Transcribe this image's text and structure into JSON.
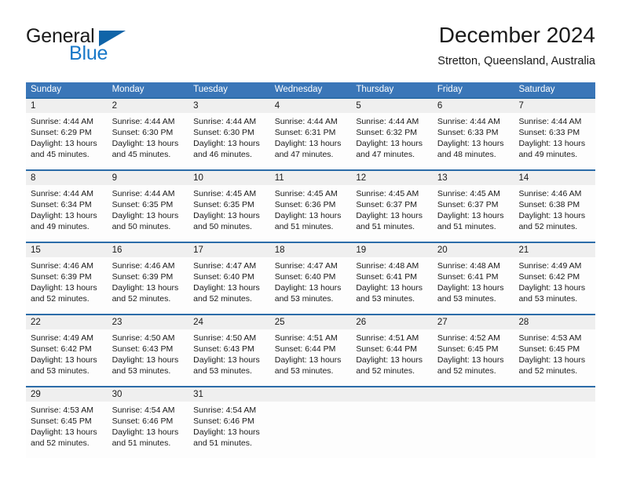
{
  "logo": {
    "text_top": "General",
    "text_bottom": "Blue",
    "icon": "triangle-logo-mark",
    "color_dark": "#1a1a1a",
    "color_blue": "#1878c8"
  },
  "header": {
    "title": "December 2024",
    "subtitle": "Stretton, Queensland, Australia"
  },
  "theme": {
    "header_blue": "#3a76b8",
    "row_divider_blue": "#2b6ca8",
    "daynum_band": "#efefef",
    "cell_background": "#fdfdfd",
    "text": "#1a1a1a"
  },
  "calendar": {
    "weekday_headers": [
      "Sunday",
      "Monday",
      "Tuesday",
      "Wednesday",
      "Thursday",
      "Friday",
      "Saturday"
    ],
    "weeks": [
      [
        {
          "day": "1",
          "sunrise": "Sunrise: 4:44 AM",
          "sunset": "Sunset: 6:29 PM",
          "daylight_1": "Daylight: 13 hours",
          "daylight_2": "and 45 minutes."
        },
        {
          "day": "2",
          "sunrise": "Sunrise: 4:44 AM",
          "sunset": "Sunset: 6:30 PM",
          "daylight_1": "Daylight: 13 hours",
          "daylight_2": "and 45 minutes."
        },
        {
          "day": "3",
          "sunrise": "Sunrise: 4:44 AM",
          "sunset": "Sunset: 6:30 PM",
          "daylight_1": "Daylight: 13 hours",
          "daylight_2": "and 46 minutes."
        },
        {
          "day": "4",
          "sunrise": "Sunrise: 4:44 AM",
          "sunset": "Sunset: 6:31 PM",
          "daylight_1": "Daylight: 13 hours",
          "daylight_2": "and 47 minutes."
        },
        {
          "day": "5",
          "sunrise": "Sunrise: 4:44 AM",
          "sunset": "Sunset: 6:32 PM",
          "daylight_1": "Daylight: 13 hours",
          "daylight_2": "and 47 minutes."
        },
        {
          "day": "6",
          "sunrise": "Sunrise: 4:44 AM",
          "sunset": "Sunset: 6:33 PM",
          "daylight_1": "Daylight: 13 hours",
          "daylight_2": "and 48 minutes."
        },
        {
          "day": "7",
          "sunrise": "Sunrise: 4:44 AM",
          "sunset": "Sunset: 6:33 PM",
          "daylight_1": "Daylight: 13 hours",
          "daylight_2": "and 49 minutes."
        }
      ],
      [
        {
          "day": "8",
          "sunrise": "Sunrise: 4:44 AM",
          "sunset": "Sunset: 6:34 PM",
          "daylight_1": "Daylight: 13 hours",
          "daylight_2": "and 49 minutes."
        },
        {
          "day": "9",
          "sunrise": "Sunrise: 4:44 AM",
          "sunset": "Sunset: 6:35 PM",
          "daylight_1": "Daylight: 13 hours",
          "daylight_2": "and 50 minutes."
        },
        {
          "day": "10",
          "sunrise": "Sunrise: 4:45 AM",
          "sunset": "Sunset: 6:35 PM",
          "daylight_1": "Daylight: 13 hours",
          "daylight_2": "and 50 minutes."
        },
        {
          "day": "11",
          "sunrise": "Sunrise: 4:45 AM",
          "sunset": "Sunset: 6:36 PM",
          "daylight_1": "Daylight: 13 hours",
          "daylight_2": "and 51 minutes."
        },
        {
          "day": "12",
          "sunrise": "Sunrise: 4:45 AM",
          "sunset": "Sunset: 6:37 PM",
          "daylight_1": "Daylight: 13 hours",
          "daylight_2": "and 51 minutes."
        },
        {
          "day": "13",
          "sunrise": "Sunrise: 4:45 AM",
          "sunset": "Sunset: 6:37 PM",
          "daylight_1": "Daylight: 13 hours",
          "daylight_2": "and 51 minutes."
        },
        {
          "day": "14",
          "sunrise": "Sunrise: 4:46 AM",
          "sunset": "Sunset: 6:38 PM",
          "daylight_1": "Daylight: 13 hours",
          "daylight_2": "and 52 minutes."
        }
      ],
      [
        {
          "day": "15",
          "sunrise": "Sunrise: 4:46 AM",
          "sunset": "Sunset: 6:39 PM",
          "daylight_1": "Daylight: 13 hours",
          "daylight_2": "and 52 minutes."
        },
        {
          "day": "16",
          "sunrise": "Sunrise: 4:46 AM",
          "sunset": "Sunset: 6:39 PM",
          "daylight_1": "Daylight: 13 hours",
          "daylight_2": "and 52 minutes."
        },
        {
          "day": "17",
          "sunrise": "Sunrise: 4:47 AM",
          "sunset": "Sunset: 6:40 PM",
          "daylight_1": "Daylight: 13 hours",
          "daylight_2": "and 52 minutes."
        },
        {
          "day": "18",
          "sunrise": "Sunrise: 4:47 AM",
          "sunset": "Sunset: 6:40 PM",
          "daylight_1": "Daylight: 13 hours",
          "daylight_2": "and 53 minutes."
        },
        {
          "day": "19",
          "sunrise": "Sunrise: 4:48 AM",
          "sunset": "Sunset: 6:41 PM",
          "daylight_1": "Daylight: 13 hours",
          "daylight_2": "and 53 minutes."
        },
        {
          "day": "20",
          "sunrise": "Sunrise: 4:48 AM",
          "sunset": "Sunset: 6:41 PM",
          "daylight_1": "Daylight: 13 hours",
          "daylight_2": "and 53 minutes."
        },
        {
          "day": "21",
          "sunrise": "Sunrise: 4:49 AM",
          "sunset": "Sunset: 6:42 PM",
          "daylight_1": "Daylight: 13 hours",
          "daylight_2": "and 53 minutes."
        }
      ],
      [
        {
          "day": "22",
          "sunrise": "Sunrise: 4:49 AM",
          "sunset": "Sunset: 6:42 PM",
          "daylight_1": "Daylight: 13 hours",
          "daylight_2": "and 53 minutes."
        },
        {
          "day": "23",
          "sunrise": "Sunrise: 4:50 AM",
          "sunset": "Sunset: 6:43 PM",
          "daylight_1": "Daylight: 13 hours",
          "daylight_2": "and 53 minutes."
        },
        {
          "day": "24",
          "sunrise": "Sunrise: 4:50 AM",
          "sunset": "Sunset: 6:43 PM",
          "daylight_1": "Daylight: 13 hours",
          "daylight_2": "and 53 minutes."
        },
        {
          "day": "25",
          "sunrise": "Sunrise: 4:51 AM",
          "sunset": "Sunset: 6:44 PM",
          "daylight_1": "Daylight: 13 hours",
          "daylight_2": "and 53 minutes."
        },
        {
          "day": "26",
          "sunrise": "Sunrise: 4:51 AM",
          "sunset": "Sunset: 6:44 PM",
          "daylight_1": "Daylight: 13 hours",
          "daylight_2": "and 52 minutes."
        },
        {
          "day": "27",
          "sunrise": "Sunrise: 4:52 AM",
          "sunset": "Sunset: 6:45 PM",
          "daylight_1": "Daylight: 13 hours",
          "daylight_2": "and 52 minutes."
        },
        {
          "day": "28",
          "sunrise": "Sunrise: 4:53 AM",
          "sunset": "Sunset: 6:45 PM",
          "daylight_1": "Daylight: 13 hours",
          "daylight_2": "and 52 minutes."
        }
      ],
      [
        {
          "day": "29",
          "sunrise": "Sunrise: 4:53 AM",
          "sunset": "Sunset: 6:45 PM",
          "daylight_1": "Daylight: 13 hours",
          "daylight_2": "and 52 minutes."
        },
        {
          "day": "30",
          "sunrise": "Sunrise: 4:54 AM",
          "sunset": "Sunset: 6:46 PM",
          "daylight_1": "Daylight: 13 hours",
          "daylight_2": "and 51 minutes."
        },
        {
          "day": "31",
          "sunrise": "Sunrise: 4:54 AM",
          "sunset": "Sunset: 6:46 PM",
          "daylight_1": "Daylight: 13 hours",
          "daylight_2": "and 51 minutes."
        },
        {
          "day": "",
          "sunrise": "",
          "sunset": "",
          "daylight_1": "",
          "daylight_2": ""
        },
        {
          "day": "",
          "sunrise": "",
          "sunset": "",
          "daylight_1": "",
          "daylight_2": ""
        },
        {
          "day": "",
          "sunrise": "",
          "sunset": "",
          "daylight_1": "",
          "daylight_2": ""
        },
        {
          "day": "",
          "sunrise": "",
          "sunset": "",
          "daylight_1": "",
          "daylight_2": ""
        }
      ]
    ]
  }
}
